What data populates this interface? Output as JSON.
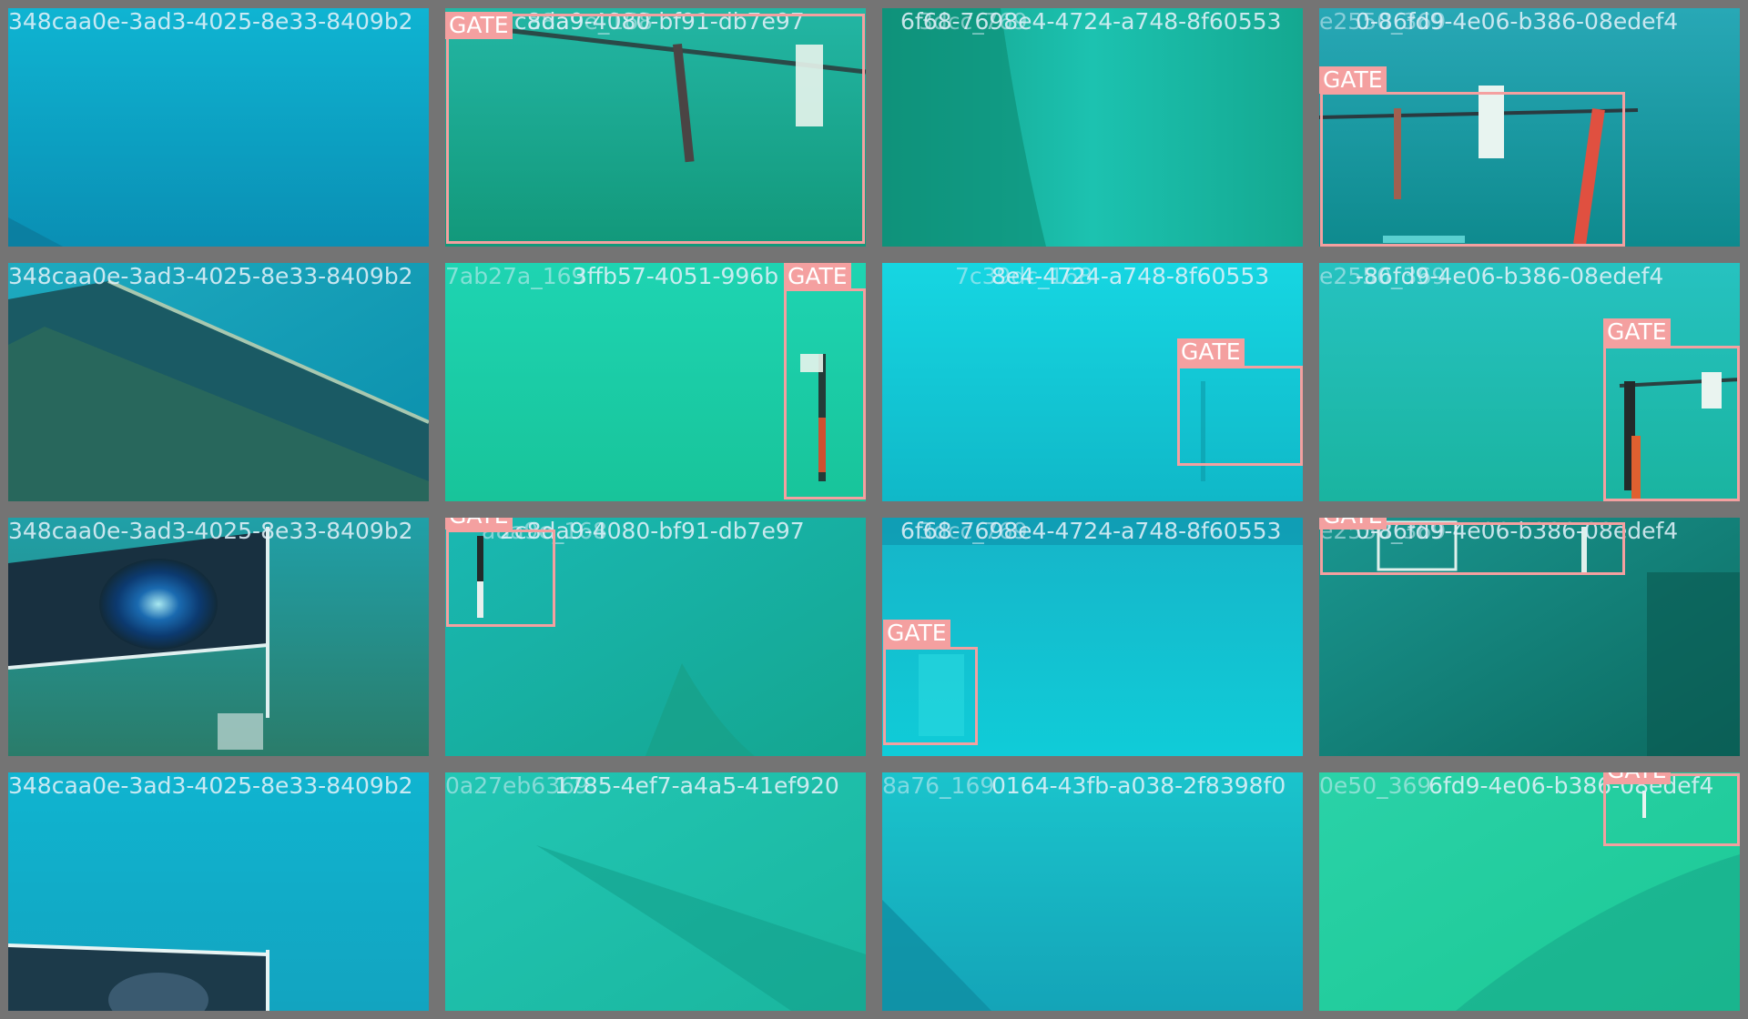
{
  "mosaic": {
    "rows": [
      {
        "tiles": [
          {
            "titles": [
              "348caa0e-3ad3-4025-8e33-8409b2"
            ],
            "gates": []
          },
          {
            "titles": [
              "2c8da9-4080-bf91-db7e97",
              "a8a9e_168"
            ],
            "gates": [
              {
                "label": "GATE"
              }
            ]
          },
          {
            "titles": [
              "6f68-7698e4-4724-a748-8f60553",
              "3dcc_769"
            ],
            "gates": []
          },
          {
            "titles": [
              "0-86fd9-4e06-b386-08edef4",
              "e2550_369"
            ],
            "gates": [
              {
                "label": "GATE"
              }
            ]
          }
        ]
      },
      {
        "tiles": [
          {
            "titles": [
              "348caa0e-3ad3-4025-8e33-8409b2"
            ],
            "gates": []
          },
          {
            "titles": [
              "3ffb57-4051-996b",
              "7ab27a_169"
            ],
            "gates": [
              {
                "label": "GATE"
              }
            ]
          },
          {
            "titles": [
              "8e4-4724-a748-8f60553",
              "7c39dc_168"
            ],
            "gates": [
              {
                "label": "GATE"
              }
            ]
          },
          {
            "titles": [
              "-86fd9-4e06-b386-08edef4",
              "e2550_369"
            ],
            "gates": [
              {
                "label": "GATE"
              }
            ]
          }
        ]
      },
      {
        "tiles": [
          {
            "titles": [
              "348caa0e-3ad3-4025-8e33-8409b2"
            ],
            "gates": []
          },
          {
            "titles": [
              "2c8da9-4080-bf91-db7e97",
              "a8a9e_168"
            ],
            "gates": [
              {
                "label": "GATE"
              }
            ]
          },
          {
            "titles": [
              "6f68-7698e4-4724-a748-8f60553",
              "3dcc_769"
            ],
            "gates": [
              {
                "label": "GATE"
              }
            ]
          },
          {
            "titles": [
              "0-86fd9-4e06-b386-08edef4",
              "e2550_369"
            ],
            "gates": [
              {
                "label": "GATE"
              }
            ]
          }
        ]
      },
      {
        "tiles": [
          {
            "titles": [
              "348caa0e-3ad3-4025-8e33-8409b2"
            ],
            "gates": []
          },
          {
            "titles": [
              "1785-4ef7-a4a5-41ef920",
              "0a27eb6369"
            ],
            "gates": []
          },
          {
            "titles": [
              "0164-43fb-a038-2f8398f0",
              "8a76_169"
            ],
            "gates": []
          },
          {
            "titles": [
              "6fd9-4e06-b386-08edef4",
              "0e50_369"
            ],
            "gates": [
              {
                "label": "GATE"
              }
            ]
          }
        ]
      }
    ]
  },
  "colors": {
    "tile_border": "#747474",
    "box_outline": "#f4a0a0",
    "label_text": "#ffffff"
  }
}
